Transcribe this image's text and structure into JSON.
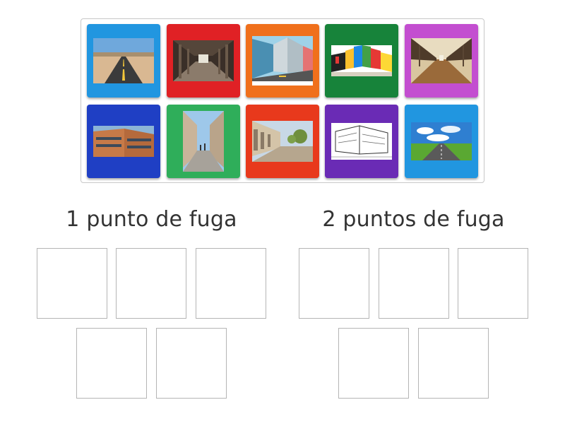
{
  "tiles": [
    {
      "name": "tile-desert-road",
      "color": "#2196e0"
    },
    {
      "name": "tile-colonnade-corridor",
      "color": "#e02125"
    },
    {
      "name": "tile-building-street-drawing",
      "color": "#f0701c"
    },
    {
      "name": "tile-colored-buildings-drawing",
      "color": "#17833a"
    },
    {
      "name": "tile-wooden-bridge",
      "color": "#c34ed0"
    },
    {
      "name": "tile-corner-building",
      "color": "#1f3fc4"
    },
    {
      "name": "tile-city-street",
      "color": "#2fae5a"
    },
    {
      "name": "tile-arcade-plaza",
      "color": "#e8391c"
    },
    {
      "name": "tile-sketch-buildings",
      "color": "#6a2bb5"
    },
    {
      "name": "tile-sky-road",
      "color": "#2196e0"
    }
  ],
  "groups": [
    {
      "title": "1 punto de fuga",
      "slots": 5
    },
    {
      "title": "2 puntos de fuga",
      "slots": 5
    }
  ]
}
